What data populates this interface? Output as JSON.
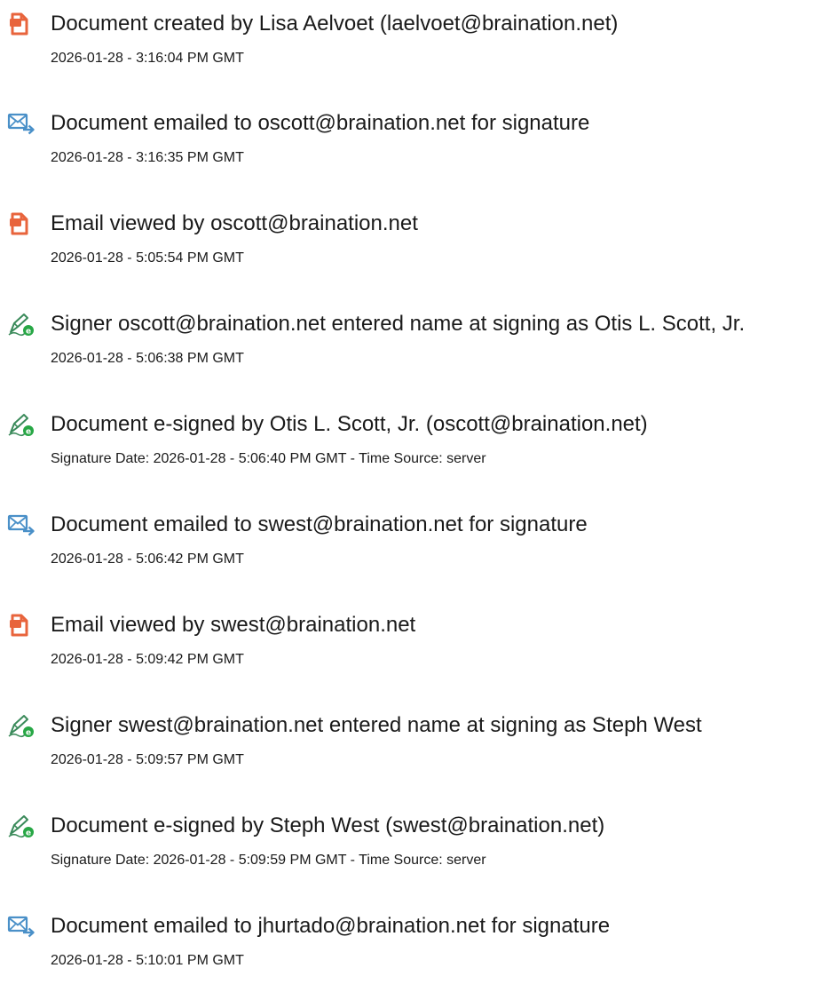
{
  "colors": {
    "created_icon": "#e8643c",
    "email_icon": "#4a90c8",
    "sign_icon": "#3a8a5a",
    "sign_badge": "#27a745"
  },
  "events": [
    {
      "icon": "document-icon",
      "title": "Document created by Lisa Aelvoet (laelvoet@braination.net)",
      "detail": "2026-01-28 - 3:16:04 PM GMT"
    },
    {
      "icon": "email-icon",
      "title": "Document emailed to oscott@braination.net for signature",
      "detail": "2026-01-28 - 3:16:35 PM GMT"
    },
    {
      "icon": "document-icon",
      "title": "Email viewed by oscott@braination.net",
      "detail": "2026-01-28 - 5:05:54 PM GMT"
    },
    {
      "icon": "pen-sign-icon",
      "title": "Signer oscott@braination.net entered name at signing as Otis L. Scott, Jr.",
      "detail": "2026-01-28 - 5:06:38 PM GMT"
    },
    {
      "icon": "pen-sign-icon",
      "title": "Document e-signed by Otis L. Scott, Jr. (oscott@braination.net)",
      "detail": "Signature Date: 2026-01-28 - 5:06:40 PM GMT - Time Source: server"
    },
    {
      "icon": "email-icon",
      "title": "Document emailed to swest@braination.net for signature",
      "detail": "2026-01-28 - 5:06:42 PM GMT"
    },
    {
      "icon": "document-icon",
      "title": "Email viewed by swest@braination.net",
      "detail": "2026-01-28 - 5:09:42 PM GMT"
    },
    {
      "icon": "pen-sign-icon",
      "title": "Signer swest@braination.net entered name at signing as Steph West",
      "detail": "2026-01-28 - 5:09:57 PM GMT"
    },
    {
      "icon": "pen-sign-icon",
      "title": "Document e-signed by Steph West (swest@braination.net)",
      "detail": "Signature Date: 2026-01-28 - 5:09:59 PM GMT - Time Source: server"
    },
    {
      "icon": "email-icon",
      "title": "Document emailed to jhurtado@braination.net for signature",
      "detail": "2026-01-28 - 5:10:01 PM GMT"
    }
  ]
}
